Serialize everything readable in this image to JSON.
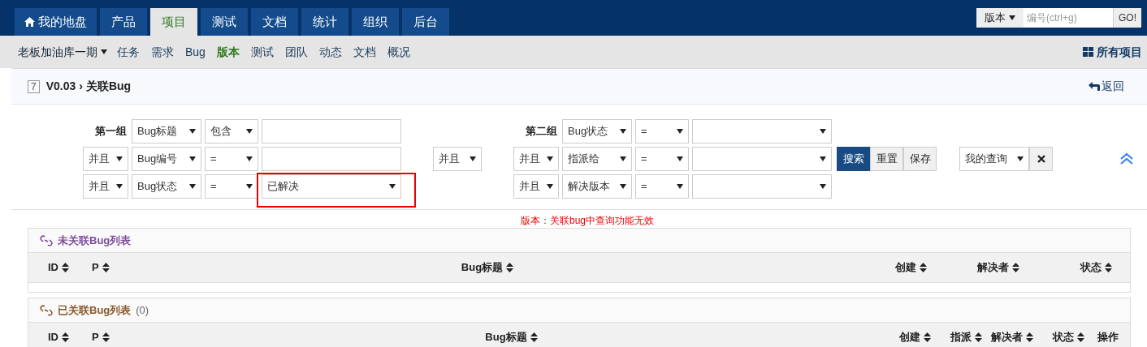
{
  "top_nav": {
    "tabs": [
      {
        "label": "我的地盘",
        "kind": "home",
        "selected": false
      },
      {
        "label": "产品",
        "kind": "plain",
        "selected": false
      },
      {
        "label": "项目",
        "kind": "plain",
        "selected": true
      },
      {
        "label": "测试",
        "kind": "plain",
        "selected": false
      },
      {
        "label": "文档",
        "kind": "plain",
        "selected": false
      },
      {
        "label": "统计",
        "kind": "plain",
        "selected": false
      },
      {
        "label": "组织",
        "kind": "plain",
        "selected": false
      },
      {
        "label": "后台",
        "kind": "plain",
        "selected": false
      }
    ],
    "search": {
      "type": "版本",
      "placeholder": "编号(ctrl+g)",
      "button": "GO!"
    }
  },
  "sub_nav": {
    "project": "老板加油库一期",
    "items": [
      {
        "label": "任务",
        "selected": false
      },
      {
        "label": "需求",
        "selected": false
      },
      {
        "label": "Bug",
        "selected": false
      },
      {
        "label": "版本",
        "selected": true
      },
      {
        "label": "测试",
        "selected": false
      },
      {
        "label": "团队",
        "selected": false
      },
      {
        "label": "动态",
        "selected": false
      },
      {
        "label": "文档",
        "selected": false
      },
      {
        "label": "概况",
        "selected": false
      }
    ],
    "all_projects": "所有项目"
  },
  "header": {
    "id": "7",
    "build": "V0.03",
    "separator": "›",
    "title": "关联Bug",
    "back": "返回"
  },
  "search_form": {
    "groups": [
      {
        "label": "第一组",
        "rows": [
          {
            "field": "Bug标题",
            "operator": "包含",
            "kind": "input"
          },
          {
            "logic": "并且",
            "field": "Bug编号",
            "operator": "=",
            "kind": "input"
          },
          {
            "logic": "并且",
            "field": "Bug状态",
            "operator": "=",
            "kind": "select",
            "value": "已解决",
            "highlighted": true
          }
        ]
      },
      {
        "label": "第二组",
        "rows": [
          {
            "field": "Bug状态",
            "operator": "=",
            "kind": "select"
          },
          {
            "logic": "并且",
            "field": "指派给",
            "operator": "=",
            "kind": "select"
          },
          {
            "logic": "并且",
            "field": "解决版本",
            "operator": "=",
            "kind": "select"
          }
        ]
      }
    ],
    "group_logic": "并且",
    "buttons": [
      {
        "label": "搜索",
        "primary": true
      },
      {
        "label": "重置",
        "primary": false
      },
      {
        "label": "保存",
        "primary": false
      }
    ],
    "saved_query": "我的查询"
  },
  "notice": "版本：关联bug中查询功能无效",
  "lists": [
    {
      "title": "未关联Bug列表",
      "color": "#7d4e9a",
      "columns": [
        {
          "label": "ID",
          "sortable": true
        },
        {
          "label": "P",
          "sortable": true
        },
        {
          "label": "Bug标题",
          "sortable": true
        },
        {
          "label": "创建",
          "sortable": true
        },
        {
          "label": "解决者",
          "sortable": true
        },
        {
          "label": "状态",
          "sortable": true
        }
      ]
    },
    {
      "title": "已关联Bug列表",
      "count": "(0)",
      "color": "#86592b",
      "columns": [
        {
          "label": "ID",
          "sortable": true
        },
        {
          "label": "P",
          "sortable": true
        },
        {
          "label": "Bug标题",
          "sortable": true
        },
        {
          "label": "创建",
          "sortable": true
        },
        {
          "label": "指派",
          "sortable": true
        },
        {
          "label": "解决者",
          "sortable": true
        },
        {
          "label": "状态",
          "sortable": true
        },
        {
          "label": "操作",
          "sortable": false
        }
      ]
    }
  ]
}
